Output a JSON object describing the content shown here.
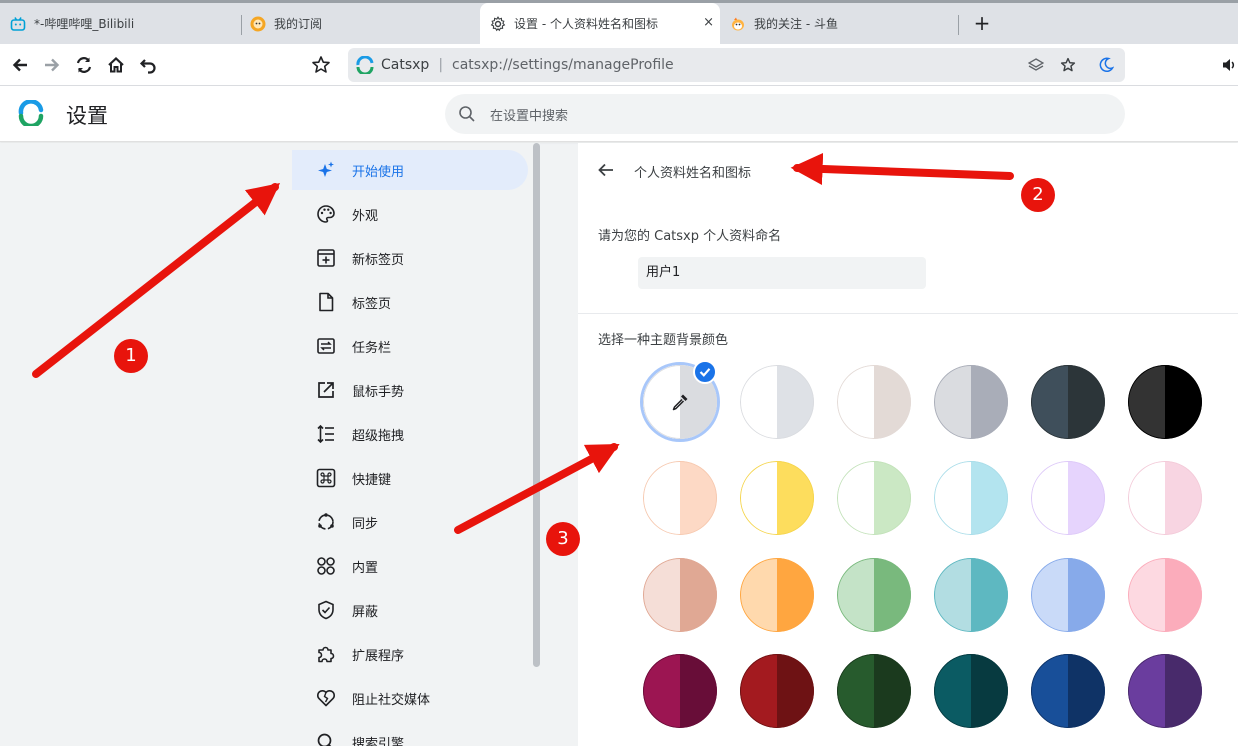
{
  "tabs": [
    {
      "label": "*-哔哩哔哩_Bilibili",
      "icon": "bilibili-icon",
      "active": false
    },
    {
      "label": "我的订阅",
      "icon": "subscription-avatar-icon",
      "active": false
    },
    {
      "label": "设置 - 个人资料姓名和图标",
      "icon": "gear-icon",
      "active": true
    },
    {
      "label": "我的关注 - 斗鱼",
      "icon": "douyu-icon",
      "active": false
    }
  ],
  "tab_close_glyph": "×",
  "new_tab_glyph": "+",
  "omnibox": {
    "site_name": "Catsxp",
    "separator": "|",
    "url": "catsxp://settings/manageProfile"
  },
  "header": {
    "title": "设置",
    "search_placeholder": "在设置中搜索"
  },
  "sidebar": {
    "items": [
      {
        "label": "开始使用",
        "icon": "sparkle-stars-icon",
        "active": true
      },
      {
        "label": "外观",
        "icon": "palette-icon"
      },
      {
        "label": "新标签页",
        "icon": "new-tab-icon"
      },
      {
        "label": "标签页",
        "icon": "document-icon"
      },
      {
        "label": "任务栏",
        "icon": "taskbar-icon"
      },
      {
        "label": "鼠标手势",
        "icon": "external-link-icon"
      },
      {
        "label": "超级拖拽",
        "icon": "line-spacing-icon"
      },
      {
        "label": "快捷键",
        "icon": "command-key-icon"
      },
      {
        "label": "同步",
        "icon": "sync-icon"
      },
      {
        "label": "内置",
        "icon": "apps-grid-icon"
      },
      {
        "label": "屏蔽",
        "icon": "shield-check-icon"
      },
      {
        "label": "扩展程序",
        "icon": "puzzle-icon"
      },
      {
        "label": "阻止社交媒体",
        "icon": "heart-broken-icon"
      },
      {
        "label": "搜索引擎",
        "icon": "search-icon"
      }
    ]
  },
  "content": {
    "title": "个人资料姓名和图标",
    "name_label": "请为您的 Catsxp 个人资料命名",
    "name_value": "用户1",
    "color_label": "选择一种主题背景颜色",
    "colors": [
      {
        "left": "#ffffff",
        "right": "#dadce0",
        "ring": "#dadce0",
        "selected": true,
        "custom": true
      },
      {
        "left": "#ffffff",
        "right": "#dee1e6",
        "ring": "#dadce0"
      },
      {
        "left": "#ffffff",
        "right": "#e3dad6",
        "ring": "#e3dad6"
      },
      {
        "left": "#dadce0",
        "right": "#a9adb8",
        "ring": "#a9adb8"
      },
      {
        "left": "#3f4f5b",
        "right": "#2c3539",
        "ring": "#2c3539"
      },
      {
        "left": "#333333",
        "right": "#000000",
        "ring": "#000000"
      },
      {
        "left": "#ffffff",
        "right": "#fdd9c5",
        "ring": "#f6c9b0"
      },
      {
        "left": "#ffffff",
        "right": "#fddd5d",
        "ring": "#f5d54d"
      },
      {
        "left": "#ffffff",
        "right": "#cbe8c4",
        "ring": "#c3e2ba"
      },
      {
        "left": "#ffffff",
        "right": "#b3e4ef",
        "ring": "#aadde9"
      },
      {
        "left": "#ffffff",
        "right": "#e6d4fd",
        "ring": "#ddc9f8"
      },
      {
        "left": "#ffffff",
        "right": "#f8d5e2",
        "ring": "#f3cbd9"
      },
      {
        "left": "#f5ded7",
        "right": "#e0a894",
        "ring": "#e0a894"
      },
      {
        "left": "#ffd9ad",
        "right": "#ffa640",
        "ring": "#ffa640"
      },
      {
        "left": "#c4e3c7",
        "right": "#79b97d",
        "ring": "#79b97d"
      },
      {
        "left": "#b2dde2",
        "right": "#5eb8c1",
        "ring": "#5eb8c1"
      },
      {
        "left": "#c9daf8",
        "right": "#87aaea",
        "ring": "#87aaea"
      },
      {
        "left": "#fdd9e1",
        "right": "#fbacbb",
        "ring": "#fbacbb"
      },
      {
        "left": "#9c1552",
        "right": "#680d38",
        "ring": "#680d38"
      },
      {
        "left": "#a31a1f",
        "right": "#6e1214",
        "ring": "#6e1214"
      },
      {
        "left": "#275b2d",
        "right": "#1b3a1e",
        "ring": "#1b3a1e"
      },
      {
        "left": "#0b5b63",
        "right": "#073a40",
        "ring": "#073a40"
      },
      {
        "left": "#184f99",
        "right": "#0f3366",
        "ring": "#0f3366"
      },
      {
        "left": "#6a3d9e",
        "right": "#482a6b",
        "ring": "#482a6b"
      }
    ]
  },
  "annotations": {
    "color": "#e8140c",
    "badges": [
      "1",
      "2",
      "3"
    ]
  }
}
